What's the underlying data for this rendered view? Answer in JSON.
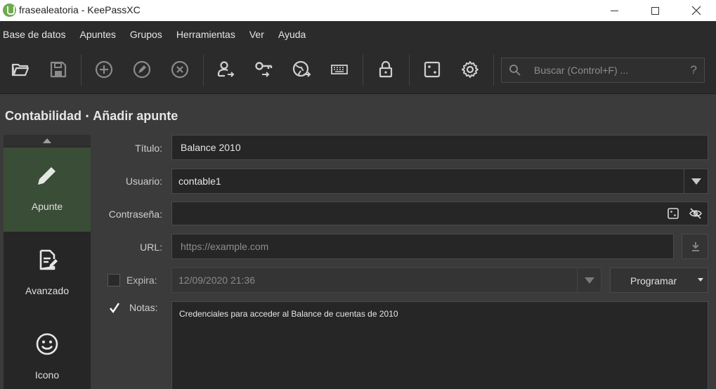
{
  "window": {
    "title": "frasealeatoria - KeePassXC"
  },
  "menu": [
    "Base de datos",
    "Apuntes",
    "Grupos",
    "Herramientas",
    "Ver",
    "Ayuda"
  ],
  "toolbar": {
    "search_placeholder": "Buscar (Control+F) ...",
    "search_help": "?",
    "icons": [
      "open-database-icon",
      "save-database-icon",
      "add-entry-icon",
      "edit-entry-icon",
      "delete-entry-icon",
      "copy-username-icon",
      "copy-password-icon",
      "open-url-icon",
      "autotype-icon",
      "lock-database-icon",
      "password-generator-icon",
      "settings-icon"
    ]
  },
  "breadcrumb": {
    "group": "Contabilidad",
    "separator": "•",
    "page": "Añadir apunte"
  },
  "categories": [
    {
      "label": "Apunte",
      "icon": "pencil-icon",
      "active": true
    },
    {
      "label": "Avanzado",
      "icon": "document-edit-icon",
      "active": false
    },
    {
      "label": "Icono",
      "icon": "smiley-icon",
      "active": false
    }
  ],
  "form": {
    "title_label": "Título:",
    "title_value": "Balance 2010",
    "username_label": "Usuario:",
    "username_value": "contable1",
    "password_label": "Contraseña:",
    "password_value": "",
    "url_label": "URL:",
    "url_placeholder": "https://example.com",
    "expires_label": "Expira:",
    "expires_checked": false,
    "expires_value": "12/09/2020 21:36",
    "schedule_label": "Programar",
    "notes_label": "Notas:",
    "notes_checked": true,
    "notes_value": "Credenciales para acceder al Balance de cuentas de 2010"
  },
  "colors": {
    "background": "#3b3b3b",
    "toolbar": "#2b2b2b",
    "active_category": "#3a4d36",
    "field": "#262626"
  }
}
